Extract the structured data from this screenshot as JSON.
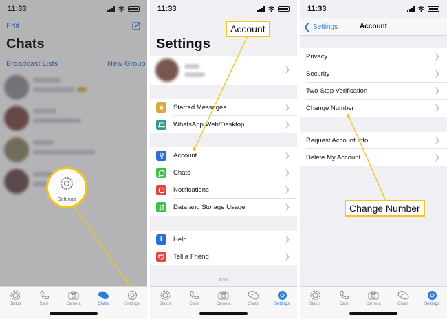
{
  "status": {
    "time": "11:33"
  },
  "panel1": {
    "edit": "Edit",
    "title": "Chats",
    "broadcast": "Broadcast Lists",
    "new_group": "New Group",
    "callout": "Settings",
    "tabs": [
      {
        "label": "Status",
        "icon": "status-icon"
      },
      {
        "label": "Calls",
        "icon": "phone-icon"
      },
      {
        "label": "Camera",
        "icon": "camera-icon"
      },
      {
        "label": "Chats",
        "icon": "chats-icon"
      },
      {
        "label": "Settings",
        "icon": "gear-icon"
      }
    ]
  },
  "panel2": {
    "title": "Settings",
    "callout": "Account",
    "group1": [
      {
        "label": "Starred Messages",
        "icon": "star-icon",
        "color": "#d9a93a"
      },
      {
        "label": "WhatsApp Web/Desktop",
        "icon": "laptop-icon",
        "color": "#2e9c8f"
      }
    ],
    "group2": [
      {
        "label": "Account",
        "icon": "key-icon",
        "color": "#2f6dd6"
      },
      {
        "label": "Chats",
        "icon": "chat-bubble-icon",
        "color": "#3fbf4d"
      },
      {
        "label": "Notifications",
        "icon": "bell-icon",
        "color": "#e0463f"
      },
      {
        "label": "Data and Storage Usage",
        "icon": "arrows-icon",
        "color": "#3fbf4d"
      }
    ],
    "group3": [
      {
        "label": "Help",
        "icon": "info-icon",
        "color": "#2f6dd6"
      },
      {
        "label": "Tell a Friend",
        "icon": "heart-icon",
        "color": "#e0463f"
      }
    ],
    "from": "from"
  },
  "panel3": {
    "back": "Settings",
    "title": "Account",
    "group1": [
      "Privacy",
      "Security",
      "Two-Step Verification",
      "Change Number"
    ],
    "group2": [
      "Request Account Info",
      "Delete My Account"
    ],
    "callout": "Change Number"
  },
  "colors": {
    "accent": "#2f7ad6",
    "callout": "#f2c51a"
  }
}
